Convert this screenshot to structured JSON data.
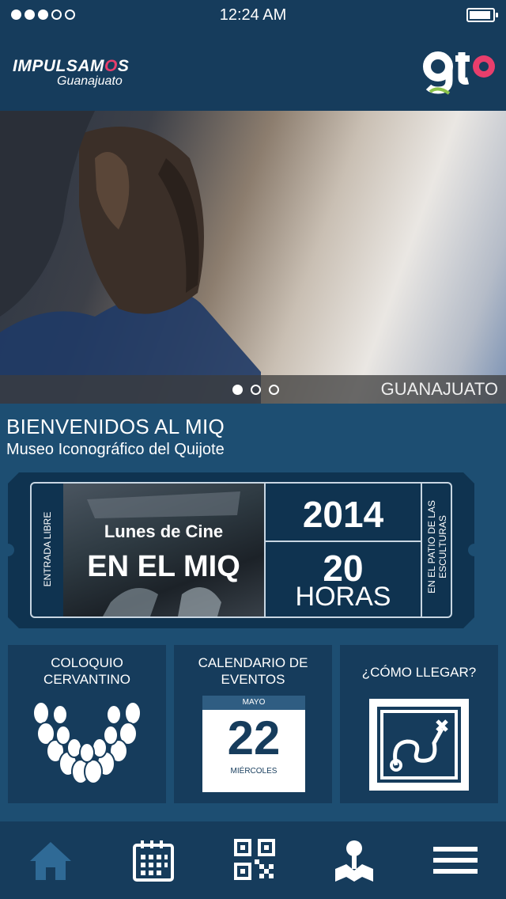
{
  "status": {
    "time": "12:24 AM",
    "signal_dots": 5,
    "signal_filled": 3
  },
  "header": {
    "brand_line1_a": "IMPULSAM",
    "brand_line1_o": "O",
    "brand_line1_b": "S",
    "brand_line2": "Guanajuato",
    "logo_text": "gto"
  },
  "hero": {
    "place": "GUANAJUATO",
    "slides": 3,
    "active_slide": 1
  },
  "welcome": {
    "title": "BIENVENIDOS AL MIQ",
    "subtitle": "Museo Iconográfico del Quijote"
  },
  "ticket": {
    "left_label": "ENTRADA LIBRE",
    "line1": "Lunes de Cine",
    "line2": "EN EL MIQ",
    "year": "2014",
    "hour": "20",
    "hour_label": "HORAS",
    "right_label_1": "EN EL PATIO DE LAS",
    "right_label_2": "ESCULTURAS"
  },
  "tiles": {
    "coloquio": {
      "line1": "COLOQUIO",
      "line2": "CERVANTINO"
    },
    "calendario": {
      "line1": "CALENDARIO DE",
      "line2": "EVENTOS",
      "month": "MAYO",
      "day": "22",
      "weekday": "MIÉRCOLES"
    },
    "llegar": {
      "line1": "¿CÓMO LLEGAR?"
    }
  },
  "colors": {
    "bg": "#1d4e72",
    "dark": "#163c5c",
    "ticket": "#0f3350",
    "accent": "#e83e6c",
    "active_nav": "#2f6a96"
  },
  "nav": [
    "home-icon",
    "calendar-icon",
    "qr-code-icon",
    "map-pin-icon",
    "menu-icon"
  ]
}
